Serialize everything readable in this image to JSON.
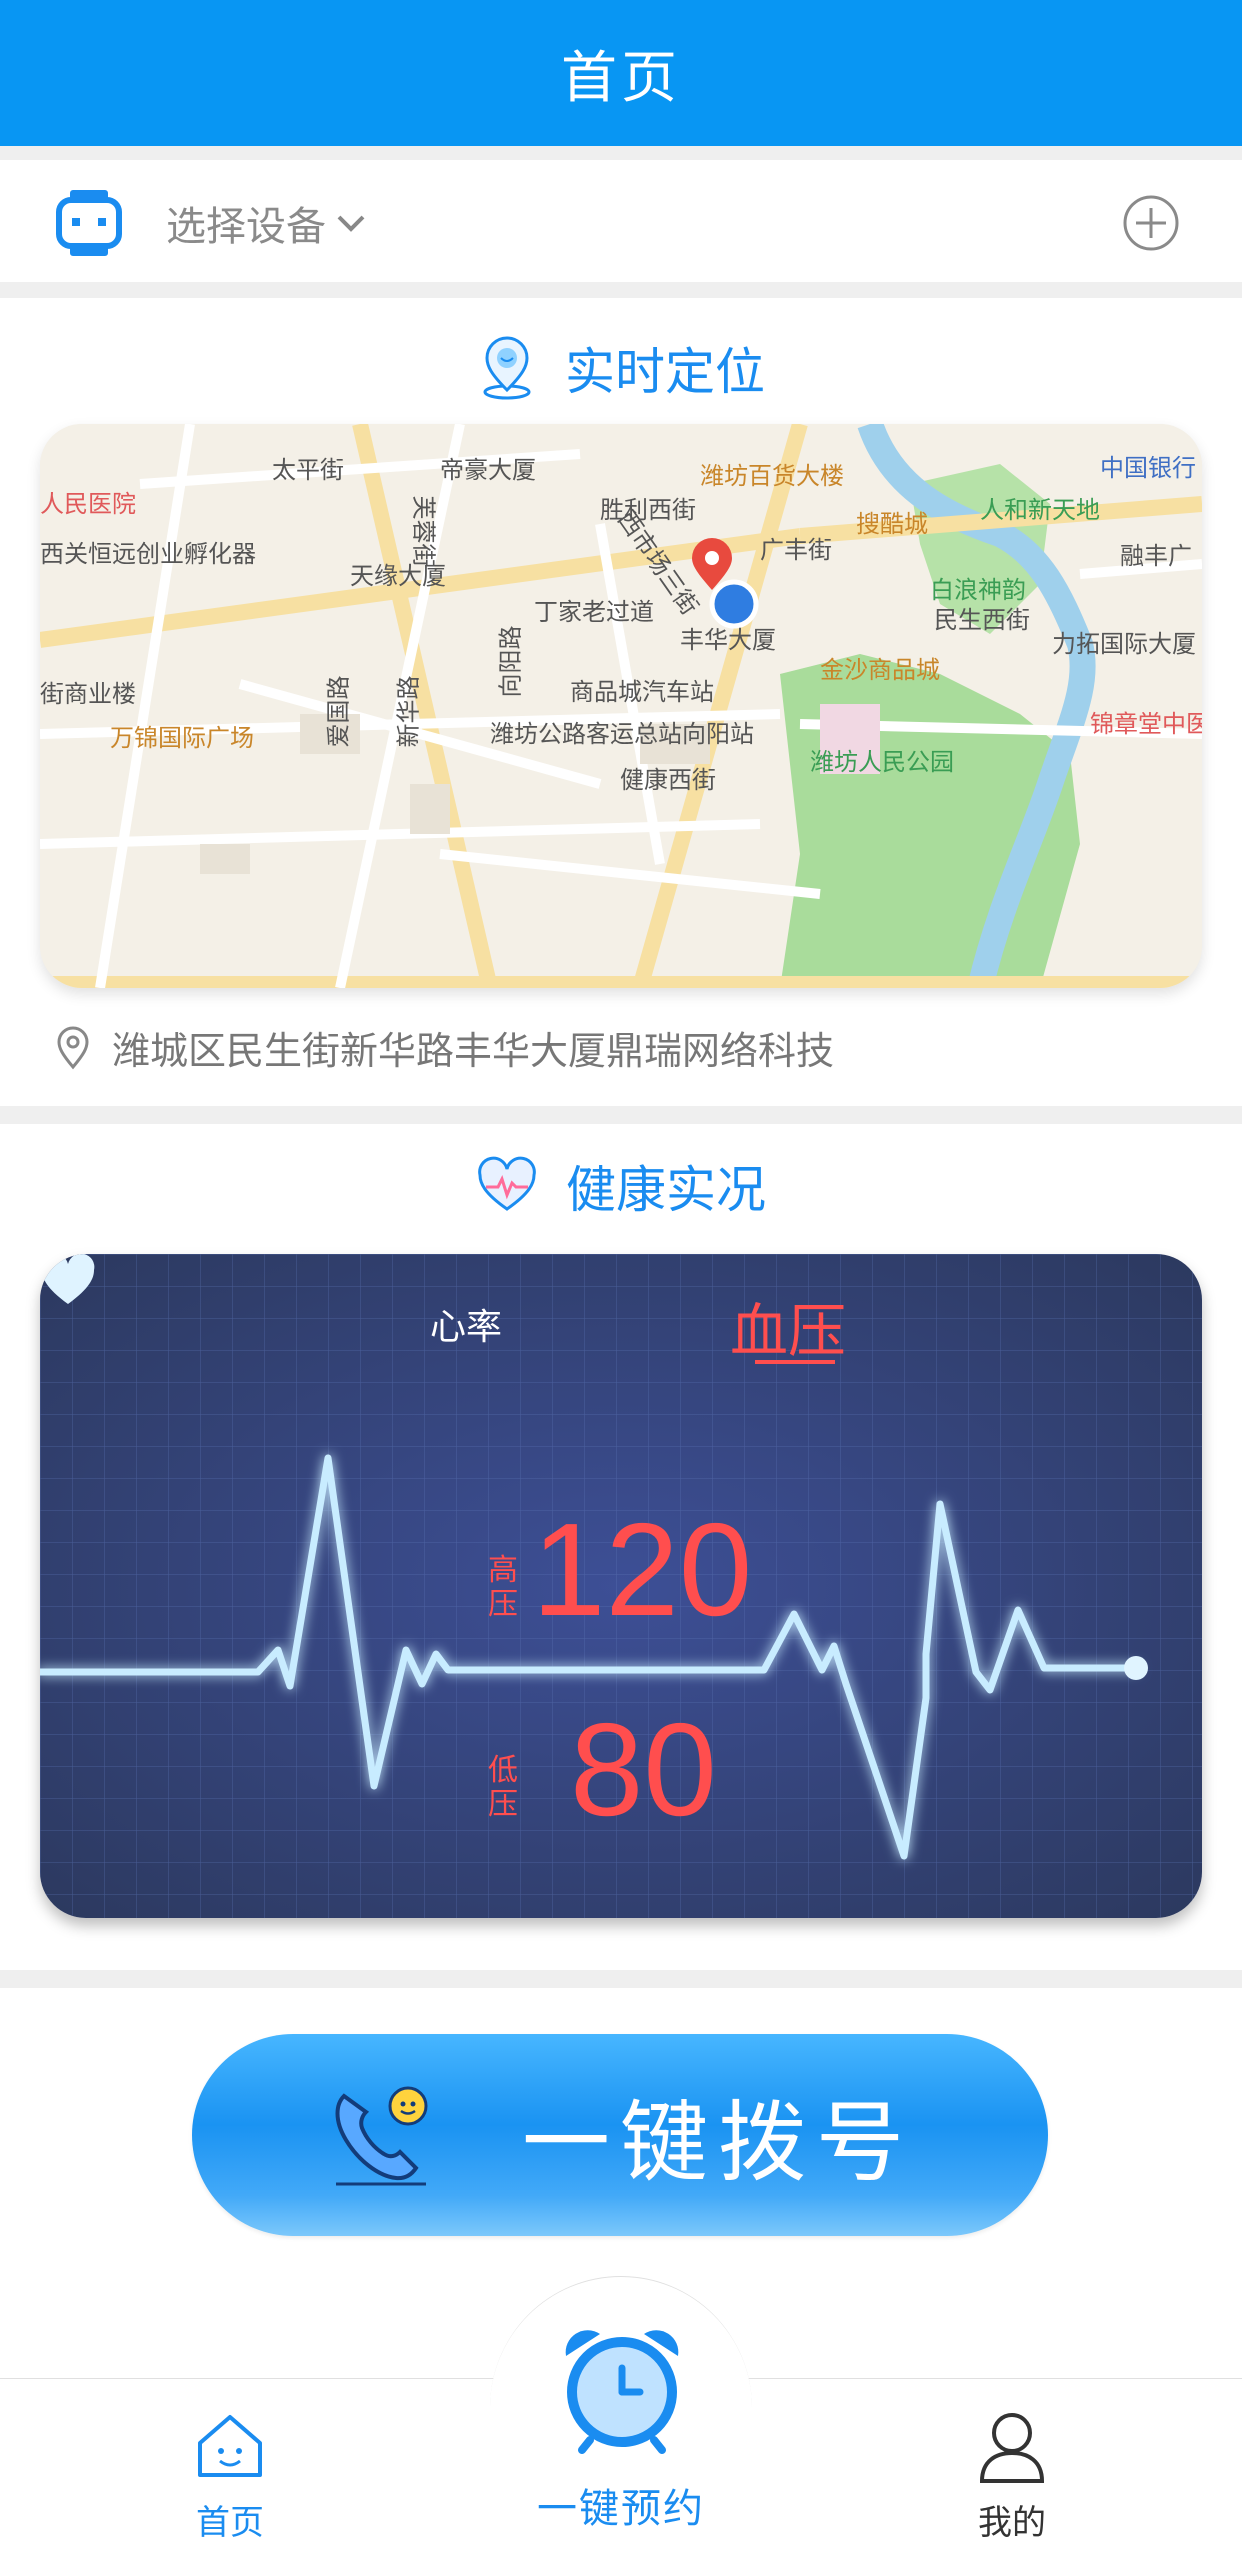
{
  "header": {
    "title": "首页"
  },
  "device": {
    "select_label": "选择设备",
    "icon": "watch-icon",
    "add_icon": "plus-circle-icon"
  },
  "location": {
    "title": "实时定位",
    "address": "潍城区民生街新华路丰华大厦鼎瑞网络科技",
    "map_labels": [
      "太平街",
      "帝豪大厦",
      "潍坊百货大楼",
      "中国银行",
      "人民医院",
      "胜利西街",
      "搜酷城",
      "人和新天地",
      "西关恒远创业孵化器",
      "天缘大厦",
      "广丰街",
      "融丰广",
      "西市场三街",
      "白浪神韵",
      "丁家老过道",
      "民生西街",
      "丰华大厦",
      "力拓国际大厦",
      "向阳路",
      "金沙商品城",
      "街商业楼",
      "商品城汽车站",
      "锦章堂中医",
      "万锦国际广场",
      "潍坊公路客运总站向阳站",
      "潍坊人民公园",
      "健康西街",
      "芙蓉街",
      "爱国路",
      "新华路"
    ]
  },
  "health": {
    "title": "健康实况",
    "tab_heart_rate": "心率",
    "tab_blood_pressure": "血压",
    "high_label": "高压",
    "high_value": "120",
    "low_label": "低压",
    "low_value": "80"
  },
  "dial": {
    "label": "一键拨号"
  },
  "nav": {
    "home": "首页",
    "appointment": "一键预约",
    "mine": "我的"
  },
  "colors": {
    "primary": "#0896f3",
    "accent_red": "#ff4e4e",
    "panel_bg": "#2f3f73"
  }
}
